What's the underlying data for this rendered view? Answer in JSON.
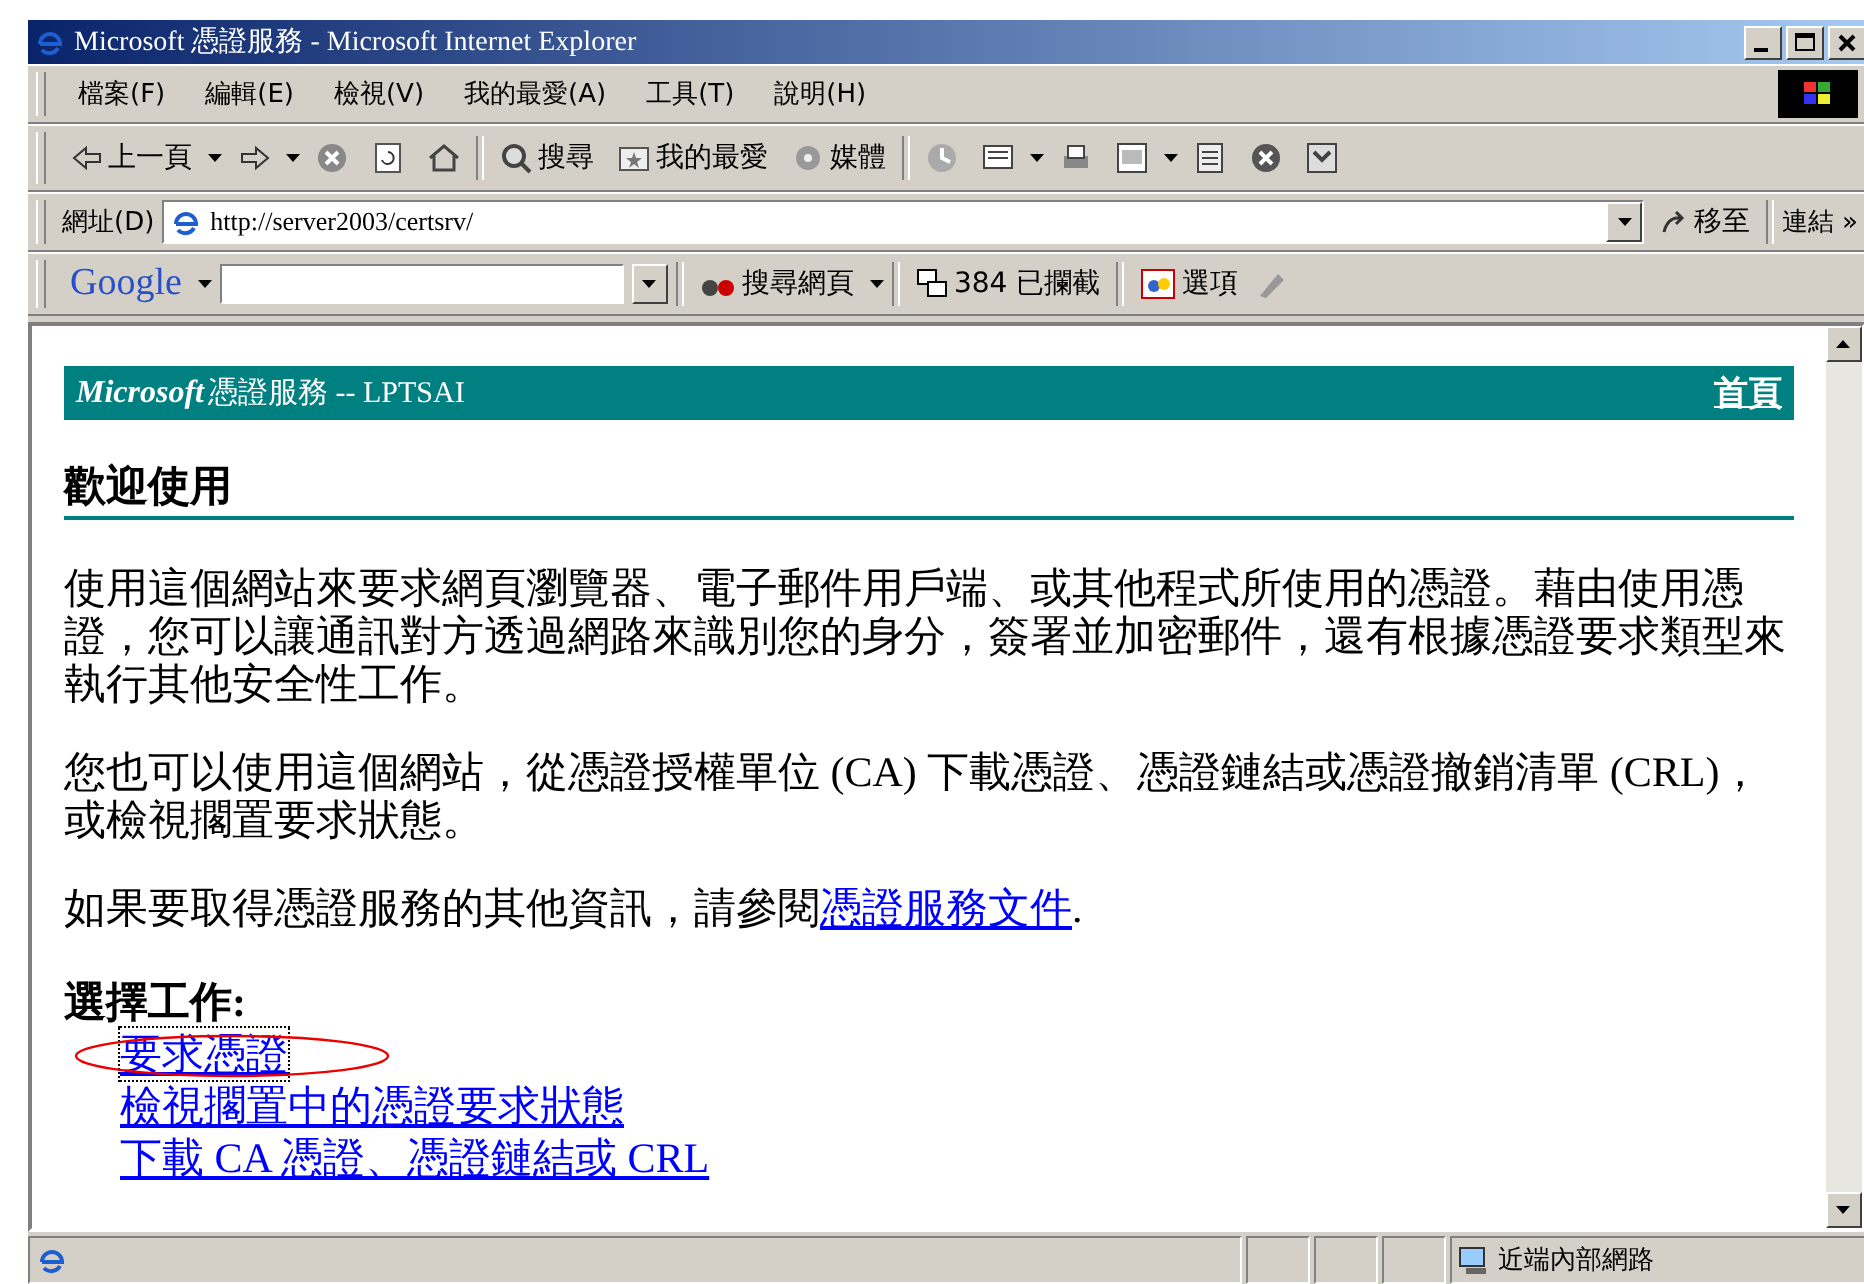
{
  "window": {
    "title": "Microsoft 憑證服務 - Microsoft Internet Explorer"
  },
  "menu": [
    "檔案(F)",
    "編輯(E)",
    "檢視(V)",
    "我的最愛(A)",
    "工具(T)",
    "說明(H)"
  ],
  "toolbar": [
    {
      "kind": "back",
      "label": "上一頁"
    },
    {
      "kind": "forward"
    },
    {
      "kind": "stop"
    },
    {
      "kind": "refresh"
    },
    {
      "kind": "home"
    },
    {
      "kind": "search",
      "label": "搜尋"
    },
    {
      "kind": "favorites",
      "label": "我的最愛"
    },
    {
      "kind": "media",
      "label": "媒體"
    },
    {
      "kind": "history"
    },
    {
      "kind": "mail"
    },
    {
      "kind": "print"
    },
    {
      "kind": "edit"
    },
    {
      "kind": "discuss"
    },
    {
      "kind": "messenger"
    },
    {
      "kind": "research"
    }
  ],
  "address": {
    "label": "網址(D)",
    "url": "http://server2003/certsrv/",
    "go": "移至",
    "links": "連結",
    "more": "»"
  },
  "google": {
    "logo": "Google",
    "search": "搜尋網頁",
    "blocked": "384 已攔截",
    "options": "選項"
  },
  "page": {
    "brand": "Microsoft",
    "service": "憑證服務  --  LPTSAI",
    "home": "首頁",
    "heading": "歡迎使用",
    "paragraphs": [
      "使用這個網站來要求網頁瀏覽器、電子郵件用戶端、或其他程式所使用的憑證。藉由使用憑證，您可以讓通訊對方透過網路來識別您的身分，簽署並加密郵件，還有根據憑證要求類型來執行其他安全性工作。",
      "您也可以使用這個網站，從憑證授權單位 (CA) 下載憑證、憑證鏈結或憑證撤銷清單 (CRL)，或檢視擱置要求狀態。"
    ],
    "info": {
      "before": "如果要取得憑證服務的其他資訊，請參閱",
      "link": "憑證服務文件",
      "after": "."
    },
    "tasks_heading": "選擇工作:",
    "tasks": [
      {
        "label": "要求憑證",
        "focused": true,
        "circled": true
      },
      {
        "label": "檢視擱置中的憑證要求狀態",
        "focused": false,
        "circled": false
      },
      {
        "label": "下載 CA 憑證、憑證鏈結或 CRL",
        "focused": false,
        "circled": false
      }
    ]
  },
  "status": {
    "zone": "近端內部網路"
  }
}
